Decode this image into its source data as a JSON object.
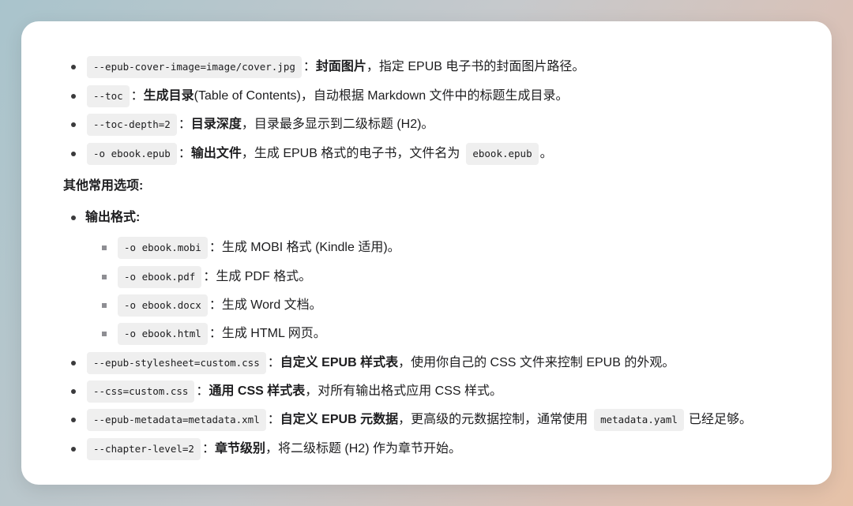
{
  "items": [
    {
      "code": "--epub-cover-image=image/cover.jpg",
      "sep": "：",
      "bold": "封面图片",
      "text": "，指定 EPUB 电子书的封面图片路径。"
    },
    {
      "code": "--toc",
      "sep": "：",
      "bold": "生成目录",
      "text": " (Table of Contents)，自动根据 Markdown 文件中的标题生成目录。"
    },
    {
      "code": "--toc-depth=2",
      "sep": "：",
      "bold": "目录深度",
      "text": "，目录最多显示到二级标题 (H2)。"
    },
    {
      "code": "-o ebook.epub",
      "sep": "：",
      "bold": "输出文件",
      "text": "，生成 EPUB 格式的电子书，文件名为",
      "code2": "ebook.epub",
      "tail": "。"
    }
  ],
  "other_heading": "其他常用选项:",
  "output_format": {
    "label": "输出格式:",
    "subitems": [
      {
        "code": "-o ebook.mobi",
        "text": "：生成 MOBI 格式 (Kindle 适用)。"
      },
      {
        "code": "-o ebook.pdf",
        "text": "：生成 PDF 格式。"
      },
      {
        "code": "-o ebook.docx",
        "text": "：生成 Word 文档。"
      },
      {
        "code": "-o ebook.html",
        "text": "：生成 HTML 网页。"
      }
    ]
  },
  "more_items": [
    {
      "code": "--epub-stylesheet=custom.css",
      "sep": "：",
      "bold": "自定义 EPUB 样式表",
      "text": "，使用你自己的 CSS 文件来控制 EPUB 的外观。"
    },
    {
      "code": "--css=custom.css",
      "sep": "：",
      "bold": "通用 CSS 样式表",
      "text": "，对所有输出格式应用 CSS 样式。"
    },
    {
      "code": "--epub-metadata=metadata.xml",
      "sep": "：",
      "bold": "自定义 EPUB 元数据",
      "text": "，更高级的元数据控制，通常使用",
      "code2": "metadata.yaml",
      "tail": "已经足够。"
    },
    {
      "code": "--chapter-level=2",
      "sep": "：",
      "bold": "章节级别",
      "text": "，将二级标题 (H2) 作为章节开始。"
    }
  ]
}
